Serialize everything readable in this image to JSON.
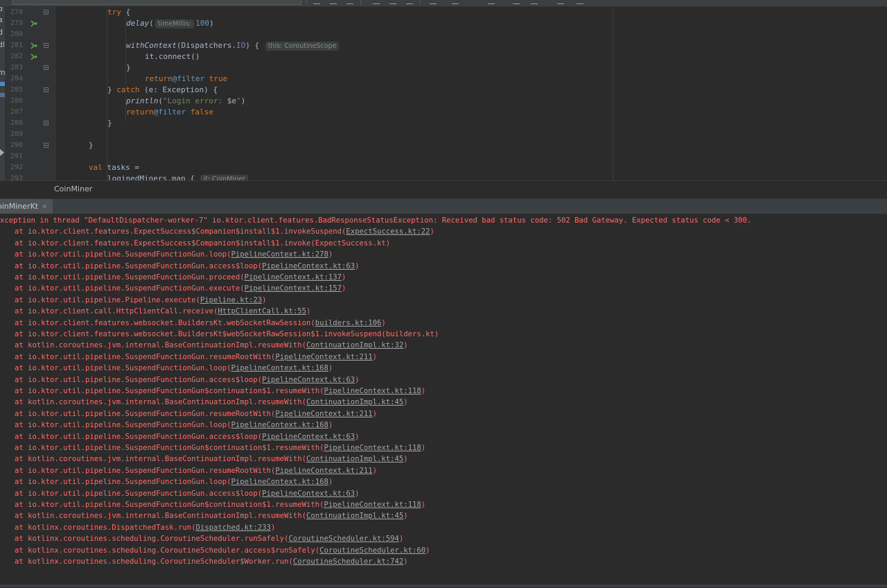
{
  "editor": {
    "gutter_lines": [
      {
        "n": "278",
        "icon": "",
        "fold": "open"
      },
      {
        "n": "279",
        "icon": "suspend-call-icon",
        "fold": ""
      },
      {
        "n": "280",
        "icon": "",
        "fold": ""
      },
      {
        "n": "281",
        "icon": "suspend-call-icon",
        "fold": "open"
      },
      {
        "n": "282",
        "icon": "suspend-call-icon",
        "fold": ""
      },
      {
        "n": "283",
        "icon": "",
        "fold": "open"
      },
      {
        "n": "284",
        "icon": "",
        "fold": ""
      },
      {
        "n": "285",
        "icon": "",
        "fold": "open"
      },
      {
        "n": "286",
        "icon": "",
        "fold": ""
      },
      {
        "n": "287",
        "icon": "",
        "fold": ""
      },
      {
        "n": "288",
        "icon": "",
        "fold": "open"
      },
      {
        "n": "289",
        "icon": "",
        "fold": ""
      },
      {
        "n": "290",
        "icon": "",
        "fold": "open"
      },
      {
        "n": "291",
        "icon": "",
        "fold": ""
      },
      {
        "n": "292",
        "icon": "",
        "fold": ""
      },
      {
        "n": "293",
        "icon": "",
        "fold": ""
      }
    ],
    "code": {
      "l278_kw": "try",
      "l278_rest": " {",
      "l279_fn": "delay",
      "l279_open": "(",
      "l279_hint": "timeMillis:",
      "l279_num": "100",
      "l279_close": ")",
      "l281_fn": "withContext",
      "l281_args": "(Dispatchers.",
      "l281_io": "IO",
      "l281_close": ") {",
      "l281_hint": "this: CoroutineScope",
      "l282_text": "it.connect()",
      "l283_text": "}",
      "l284_kw": "return",
      "l284_lbl": "@filter",
      "l284_val": " true",
      "l285_brace": "} ",
      "l285_kw": "catch",
      "l285_rest": " (e: Exception) {",
      "l286_fn": "println",
      "l286_open": "(",
      "l286_str": "\"Login error: ",
      "l286_var": "$e",
      "l286_strend": "\"",
      "l286_close": ")",
      "l287_kw": "return",
      "l287_lbl": "@filter",
      "l287_val": " false",
      "l288_text": "}",
      "l290_text": "}",
      "l292_kw": "val",
      "l292_rest": " tasks =",
      "l293_text": "loginedMiners.map {",
      "l293_hint": "it: CoinMiner"
    }
  },
  "side_strip": {
    "letters": [
      "d",
      "a",
      "d",
      "dl",
      "m"
    ]
  },
  "breadcrumb": {
    "label": "CoinMiner"
  },
  "run_panel": {
    "tab_label": "oinMinerKt",
    "tab_close": "×"
  },
  "console": {
    "header": "xception in thread \"DefaultDispatcher-worker-7\" io.ktor.client.features.BadResponseStatusException: Received bad status code: 502 Bad Gateway. Expected status code < 300.",
    "frames": [
      {
        "method": "at io.ktor.client.features.ExpectSuccess$Companion$install$1.invokeSuspend(",
        "source": "ExpectSuccess.kt:22",
        "linked": true
      },
      {
        "method": "at io.ktor.client.features.ExpectSuccess$Companion$install$1.invoke(",
        "source": "ExpectSuccess.kt",
        "linked": false
      },
      {
        "method": "at io.ktor.util.pipeline.SuspendFunctionGun.loop(",
        "source": "PipelineContext.kt:278",
        "linked": true
      },
      {
        "method": "at io.ktor.util.pipeline.SuspendFunctionGun.access$loop(",
        "source": "PipelineContext.kt:63",
        "linked": true
      },
      {
        "method": "at io.ktor.util.pipeline.SuspendFunctionGun.proceed(",
        "source": "PipelineContext.kt:137",
        "linked": true
      },
      {
        "method": "at io.ktor.util.pipeline.SuspendFunctionGun.execute(",
        "source": "PipelineContext.kt:157",
        "linked": true
      },
      {
        "method": "at io.ktor.util.pipeline.Pipeline.execute(",
        "source": "Pipeline.kt:23",
        "linked": true
      },
      {
        "method": "at io.ktor.client.call.HttpClientCall.receive(",
        "source": "HttpClientCall.kt:55",
        "linked": true
      },
      {
        "method": "at io.ktor.client.features.websocket.BuildersKt.webSocketRawSession(",
        "source": "builders.kt:106",
        "linked": true
      },
      {
        "method": "at io.ktor.client.features.websocket.BuildersKt$webSocketRawSession$1.invokeSuspend(",
        "source": "builders.kt",
        "linked": false
      },
      {
        "method": "at kotlin.coroutines.jvm.internal.BaseContinuationImpl.resumeWith(",
        "source": "ContinuationImpl.kt:32",
        "linked": true
      },
      {
        "method": "at io.ktor.util.pipeline.SuspendFunctionGun.resumeRootWith(",
        "source": "PipelineContext.kt:211",
        "linked": true
      },
      {
        "method": "at io.ktor.util.pipeline.SuspendFunctionGun.loop(",
        "source": "PipelineContext.kt:168",
        "linked": true
      },
      {
        "method": "at io.ktor.util.pipeline.SuspendFunctionGun.access$loop(",
        "source": "PipelineContext.kt:63",
        "linked": true
      },
      {
        "method": "at io.ktor.util.pipeline.SuspendFunctionGun$continuation$1.resumeWith(",
        "source": "PipelineContext.kt:118",
        "linked": true
      },
      {
        "method": "at kotlin.coroutines.jvm.internal.BaseContinuationImpl.resumeWith(",
        "source": "ContinuationImpl.kt:45",
        "linked": true
      },
      {
        "method": "at io.ktor.util.pipeline.SuspendFunctionGun.resumeRootWith(",
        "source": "PipelineContext.kt:211",
        "linked": true
      },
      {
        "method": "at io.ktor.util.pipeline.SuspendFunctionGun.loop(",
        "source": "PipelineContext.kt:168",
        "linked": true
      },
      {
        "method": "at io.ktor.util.pipeline.SuspendFunctionGun.access$loop(",
        "source": "PipelineContext.kt:63",
        "linked": true
      },
      {
        "method": "at io.ktor.util.pipeline.SuspendFunctionGun$continuation$1.resumeWith(",
        "source": "PipelineContext.kt:118",
        "linked": true
      },
      {
        "method": "at kotlin.coroutines.jvm.internal.BaseContinuationImpl.resumeWith(",
        "source": "ContinuationImpl.kt:45",
        "linked": true
      },
      {
        "method": "at io.ktor.util.pipeline.SuspendFunctionGun.resumeRootWith(",
        "source": "PipelineContext.kt:211",
        "linked": true
      },
      {
        "method": "at io.ktor.util.pipeline.SuspendFunctionGun.loop(",
        "source": "PipelineContext.kt:168",
        "linked": true
      },
      {
        "method": "at io.ktor.util.pipeline.SuspendFunctionGun.access$loop(",
        "source": "PipelineContext.kt:63",
        "linked": true
      },
      {
        "method": "at io.ktor.util.pipeline.SuspendFunctionGun$continuation$1.resumeWith(",
        "source": "PipelineContext.kt:118",
        "linked": true
      },
      {
        "method": "at kotlin.coroutines.jvm.internal.BaseContinuationImpl.resumeWith(",
        "source": "ContinuationImpl.kt:45",
        "linked": true
      },
      {
        "method": "at kotlinx.coroutines.DispatchedTask.run(",
        "source": "Dispatched.kt:233",
        "linked": true
      },
      {
        "method": "at kotlinx.coroutines.scheduling.CoroutineScheduler.runSafely(",
        "source": "CoroutineScheduler.kt:594",
        "linked": true
      },
      {
        "method": "at kotlinx.coroutines.scheduling.CoroutineScheduler.access$runSafely(",
        "source": "CoroutineScheduler.kt:60",
        "linked": true
      },
      {
        "method": "at kotlinx.coroutines.scheduling.CoroutineScheduler$Worker.run(",
        "source": "CoroutineScheduler.kt:742",
        "linked": true
      }
    ],
    "close_paren": ")"
  },
  "colors": {
    "error_text": "#ff6b68",
    "link_text": "#a6a6a6",
    "editor_bg": "#2b2b2b",
    "gutter_bg": "#313335"
  }
}
